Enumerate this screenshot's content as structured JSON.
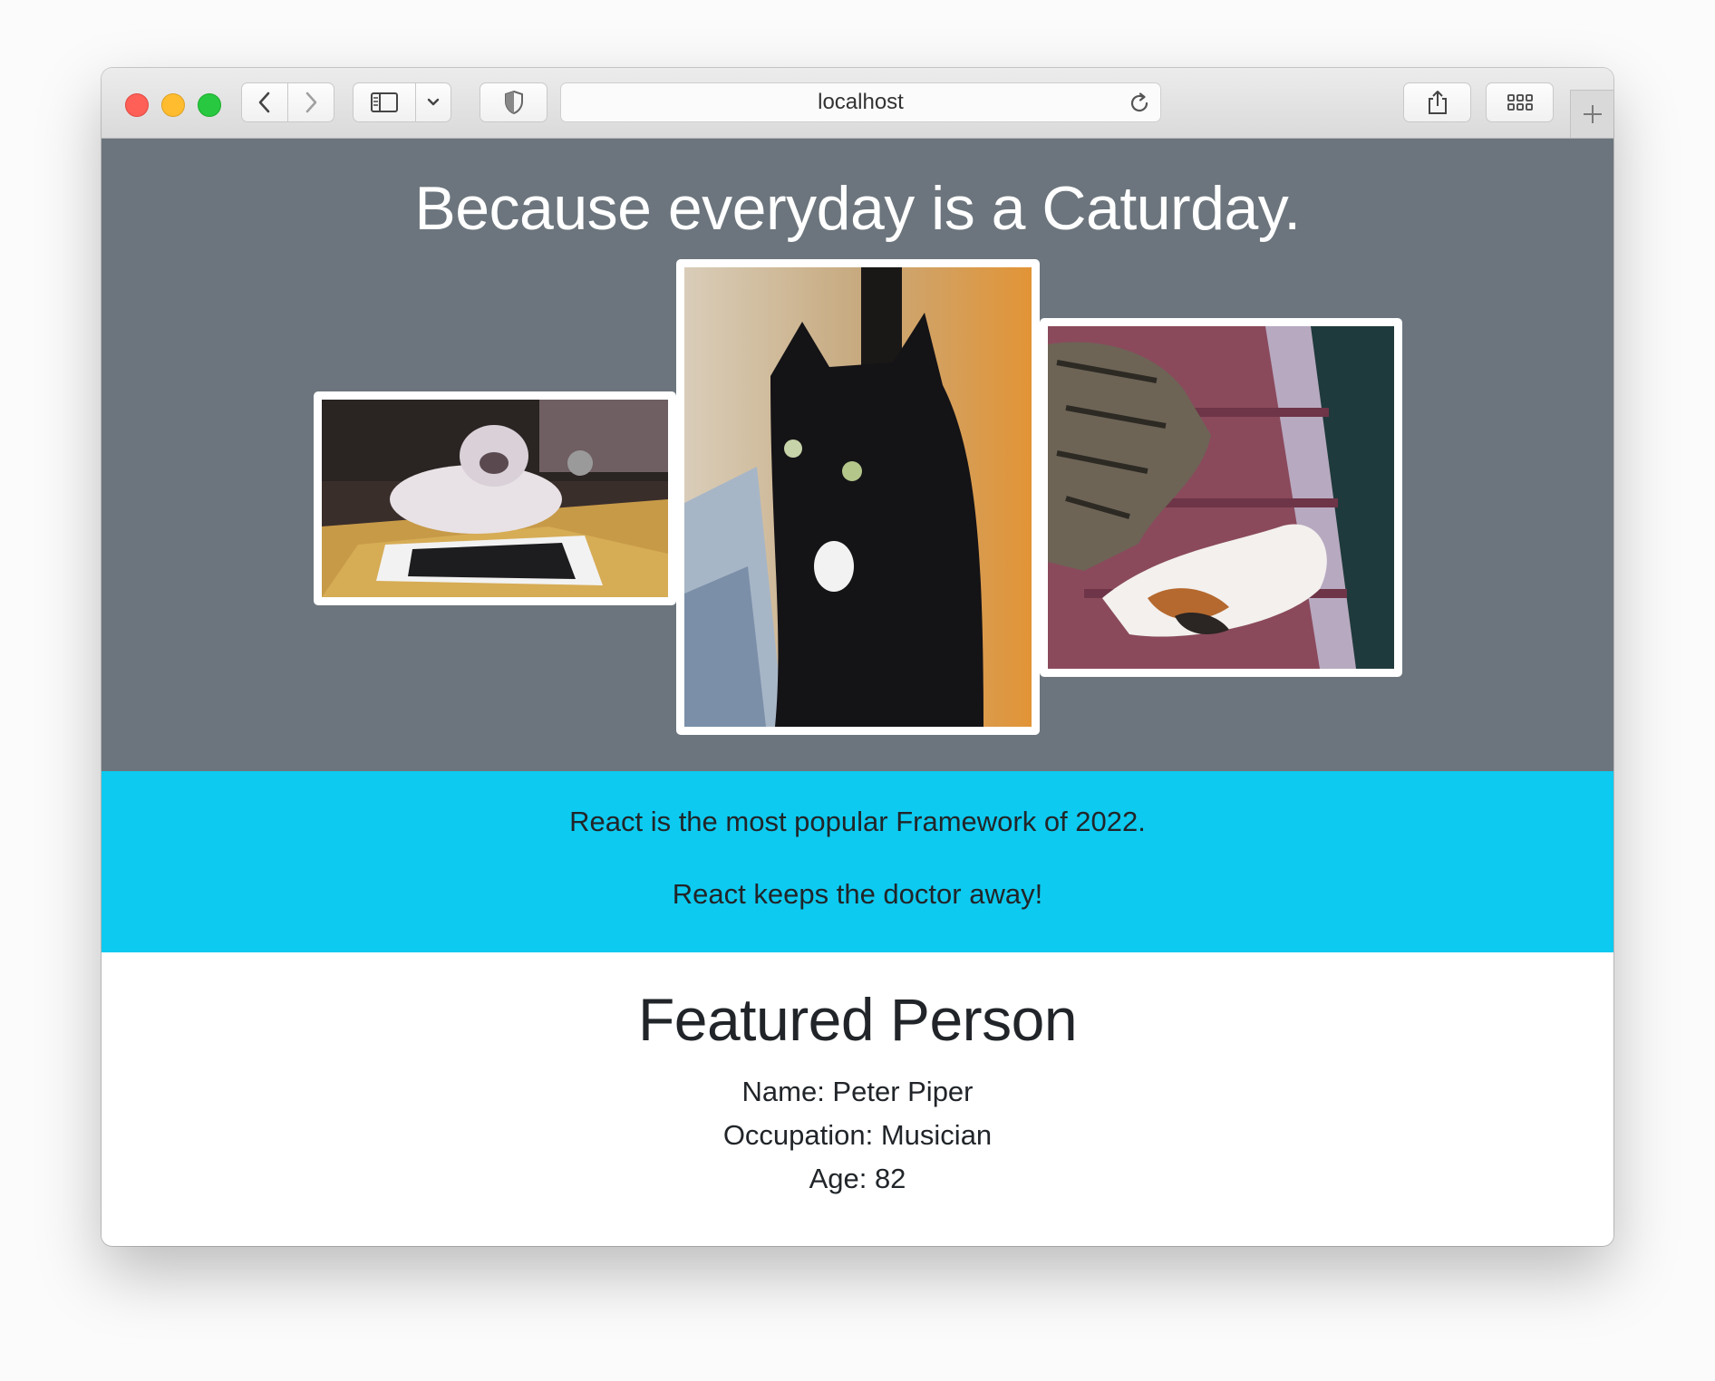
{
  "browser": {
    "address": "localhost"
  },
  "hero": {
    "title": "Because everyday is a Caturday."
  },
  "info": {
    "line1": "React is the most popular Framework of 2022.",
    "line2": "React keeps the doctor away!"
  },
  "featured": {
    "title": "Featured Person",
    "name": "Name: Peter Piper",
    "occupation": "Occupation: Musician",
    "age": "Age: 82"
  },
  "colors": {
    "hero_bg": "#6c757d",
    "info_bg": "#0dcaf0",
    "text_dark": "#212529"
  },
  "icons": [
    "back-icon",
    "forward-icon",
    "sidebar-icon",
    "chevron-down-icon",
    "shield-icon",
    "reload-icon",
    "share-icon",
    "tab-overview-icon",
    "plus-icon"
  ]
}
